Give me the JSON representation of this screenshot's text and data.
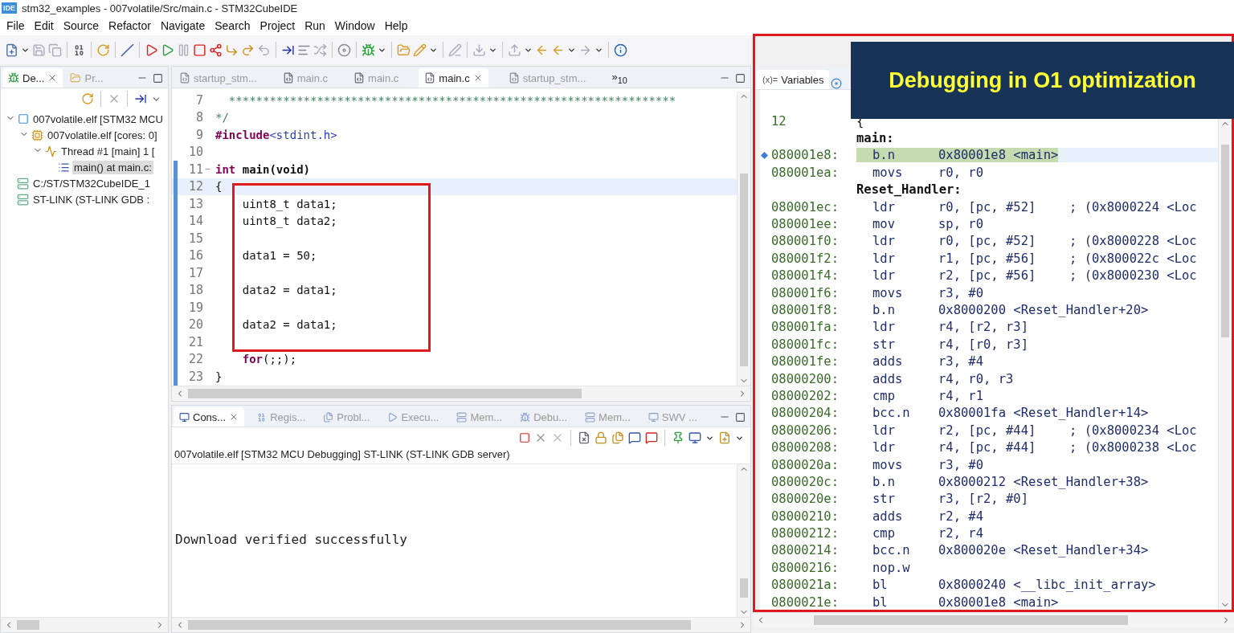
{
  "window": {
    "title": "stm32_examples - 007volatile/Src/main.c - STM32CubeIDE",
    "app_badge": "IDE"
  },
  "menu": [
    "File",
    "Edit",
    "Source",
    "Refactor",
    "Navigate",
    "Search",
    "Project",
    "Run",
    "Window",
    "Help"
  ],
  "debug_view": {
    "tabs": [
      {
        "label": "De...",
        "selected": true
      },
      {
        "label": "Pr...",
        "selected": false
      }
    ],
    "tree": [
      {
        "label": "007volatile.elf [STM32 MCU",
        "kind": "launch",
        "expanded": true,
        "selected": false,
        "children": [
          {
            "label": "007volatile.elf [cores: 0]",
            "kind": "process",
            "expanded": true,
            "selected": false,
            "children": [
              {
                "label": "Thread #1 [main] 1 [",
                "kind": "thread",
                "expanded": true,
                "selected": false,
                "children": [
                  {
                    "label": "main() at main.c:",
                    "kind": "frame",
                    "selected": true
                  }
                ]
              }
            ]
          }
        ]
      },
      {
        "label": "C:/ST/STM32CubeIDE_1",
        "kind": "server",
        "selected": false
      },
      {
        "label": "ST-LINK (ST-LINK GDB :",
        "kind": "server",
        "selected": false
      }
    ]
  },
  "editor": {
    "tabs": [
      {
        "label": "startup_stm...",
        "kind": "asm",
        "selected": false
      },
      {
        "label": "main.c",
        "kind": "c",
        "selected": false
      },
      {
        "label": "main.c",
        "kind": "c",
        "selected": false
      },
      {
        "label": "main.c",
        "kind": "c",
        "selected": true
      },
      {
        "label": "startup_stm...",
        "kind": "asm",
        "selected": false
      }
    ],
    "overflow": "»$_{10}$",
    "lines": [
      {
        "number": "7",
        "ruler": false,
        "fold": false,
        "current": false,
        "parts": [
          {
            "kind": "comment",
            "text": "  ******************************************************************"
          }
        ]
      },
      {
        "number": "8",
        "ruler": false,
        "fold": false,
        "current": false,
        "parts": [
          {
            "kind": "comment",
            "text": "*/"
          }
        ]
      },
      {
        "number": "9",
        "ruler": false,
        "fold": false,
        "current": false,
        "parts": [
          {
            "kind": "preproc",
            "text": "#include"
          },
          {
            "kind": "string",
            "text": "<stdint.h>"
          }
        ]
      },
      {
        "number": "10",
        "ruler": false,
        "fold": false,
        "current": false
      },
      {
        "number": "11",
        "ruler": true,
        "fold": true,
        "current": false,
        "parts": [
          {
            "kind": "keyword",
            "text": "int"
          },
          {
            "kind": "bold",
            "text": " main(void)"
          }
        ]
      },
      {
        "number": "12",
        "ruler": true,
        "fold": false,
        "current": true,
        "parts": [
          {
            "kind": "code",
            "text": "{"
          }
        ]
      },
      {
        "number": "13",
        "ruler": true,
        "fold": false,
        "current": false,
        "parts": [
          {
            "kind": "code",
            "text": "    uint8_t data1;"
          }
        ]
      },
      {
        "number": "14",
        "ruler": true,
        "fold": false,
        "current": false,
        "parts": [
          {
            "kind": "code",
            "text": "    uint8_t data2;"
          }
        ]
      },
      {
        "number": "15",
        "ruler": true,
        "fold": false,
        "current": false
      },
      {
        "number": "16",
        "ruler": true,
        "fold": false,
        "current": false,
        "parts": [
          {
            "kind": "code",
            "text": "    data1 = 50;"
          }
        ]
      },
      {
        "number": "17",
        "ruler": true,
        "fold": false,
        "current": false
      },
      {
        "number": "18",
        "ruler": true,
        "fold": false,
        "current": false,
        "parts": [
          {
            "kind": "code",
            "text": "    data2 = data1;"
          }
        ]
      },
      {
        "number": "19",
        "ruler": true,
        "fold": false,
        "current": false
      },
      {
        "number": "20",
        "ruler": true,
        "fold": false,
        "current": false,
        "parts": [
          {
            "kind": "code",
            "text": "    data2 = data1;"
          }
        ]
      },
      {
        "number": "21",
        "ruler": true,
        "fold": false,
        "current": false
      },
      {
        "number": "22",
        "ruler": true,
        "fold": false,
        "current": false,
        "parts": [
          {
            "kind": "keyword",
            "text": "    for"
          },
          {
            "kind": "code",
            "text": "(;;);"
          }
        ]
      },
      {
        "number": "23",
        "ruler": true,
        "fold": false,
        "current": false,
        "parts": [
          {
            "kind": "code",
            "text": "}"
          }
        ]
      }
    ]
  },
  "console": {
    "tabs": [
      {
        "label": "Cons...",
        "selected": true
      },
      {
        "label": "Regis...",
        "selected": false
      },
      {
        "label": "Probl...",
        "selected": false
      },
      {
        "label": "Execu...",
        "selected": false
      },
      {
        "label": "Mem...",
        "selected": false
      },
      {
        "label": "Debu...",
        "selected": false
      },
      {
        "label": "Mem...",
        "selected": false
      },
      {
        "label": "SWV ...",
        "selected": false
      }
    ],
    "header": "007volatile.elf [STM32 MCU Debugging] ST-LINK (ST-LINK GDB server)",
    "output": "Download verified successfully"
  },
  "disassembly": {
    "tabs": [
      {
        "glyph": "(x)=",
        "label": "Variables",
        "selected": true
      }
    ],
    "rows": [
      {
        "kind": "source",
        "address": "12",
        "text": "{"
      },
      {
        "kind": "label",
        "text": "main:"
      },
      {
        "kind": "instruction",
        "current": true,
        "address": "080001e8:",
        "mnemonic": "b.n",
        "operand": "0x80001e8 <main>"
      },
      {
        "kind": "instruction",
        "current": false,
        "address": "080001ea:",
        "mnemonic": "movs",
        "operand": "r0, r0"
      },
      {
        "kind": "label",
        "text": "Reset_Handler:"
      },
      {
        "kind": "instruction",
        "current": false,
        "address": "080001ec:",
        "mnemonic": "ldr",
        "operand": "r0, [pc, #52]",
        "comment": "; (0x8000224 <Loc"
      },
      {
        "kind": "instruction",
        "current": false,
        "address": "080001ee:",
        "mnemonic": "mov",
        "operand": "sp, r0"
      },
      {
        "kind": "instruction",
        "current": false,
        "address": "080001f0:",
        "mnemonic": "ldr",
        "operand": "r0, [pc, #52]",
        "comment": "; (0x8000228 <Loc"
      },
      {
        "kind": "instruction",
        "current": false,
        "address": "080001f2:",
        "mnemonic": "ldr",
        "operand": "r1, [pc, #56]",
        "comment": "; (0x800022c <Loc"
      },
      {
        "kind": "instruction",
        "current": false,
        "address": "080001f4:",
        "mnemonic": "ldr",
        "operand": "r2, [pc, #56]",
        "comment": "; (0x8000230 <Loc"
      },
      {
        "kind": "instruction",
        "current": false,
        "address": "080001f6:",
        "mnemonic": "movs",
        "operand": "r3, #0"
      },
      {
        "kind": "instruction",
        "current": false,
        "address": "080001f8:",
        "mnemonic": "b.n",
        "operand": "0x8000200 <Reset_Handler+20>"
      },
      {
        "kind": "instruction",
        "current": false,
        "address": "080001fa:",
        "mnemonic": "ldr",
        "operand": "r4, [r2, r3]"
      },
      {
        "kind": "instruction",
        "current": false,
        "address": "080001fc:",
        "mnemonic": "str",
        "operand": "r4, [r0, r3]"
      },
      {
        "kind": "instruction",
        "current": false,
        "address": "080001fe:",
        "mnemonic": "adds",
        "operand": "r3, #4"
      },
      {
        "kind": "instruction",
        "current": false,
        "address": "08000200:",
        "mnemonic": "adds",
        "operand": "r4, r0, r3"
      },
      {
        "kind": "instruction",
        "current": false,
        "address": "08000202:",
        "mnemonic": "cmp",
        "operand": "r4, r1"
      },
      {
        "kind": "instruction",
        "current": false,
        "address": "08000204:",
        "mnemonic": "bcc.n",
        "operand": "0x80001fa <Reset_Handler+14>"
      },
      {
        "kind": "instruction",
        "current": false,
        "address": "08000206:",
        "mnemonic": "ldr",
        "operand": "r2, [pc, #44]",
        "comment": "; (0x8000234 <Loc"
      },
      {
        "kind": "instruction",
        "current": false,
        "address": "08000208:",
        "mnemonic": "ldr",
        "operand": "r4, [pc, #44]",
        "comment": "; (0x8000238 <Loc"
      },
      {
        "kind": "instruction",
        "current": false,
        "address": "0800020a:",
        "mnemonic": "movs",
        "operand": "r3, #0"
      },
      {
        "kind": "instruction",
        "current": false,
        "address": "0800020c:",
        "mnemonic": "b.n",
        "operand": "0x8000212 <Reset_Handler+38>"
      },
      {
        "kind": "instruction",
        "current": false,
        "address": "0800020e:",
        "mnemonic": "str",
        "operand": "r3, [r2, #0]"
      },
      {
        "kind": "instruction",
        "current": false,
        "address": "08000210:",
        "mnemonic": "adds",
        "operand": "r2, #4"
      },
      {
        "kind": "instruction",
        "current": false,
        "address": "08000212:",
        "mnemonic": "cmp",
        "operand": "r2, r4"
      },
      {
        "kind": "instruction",
        "current": false,
        "address": "08000214:",
        "mnemonic": "bcc.n",
        "operand": "0x800020e <Reset_Handler+34>"
      },
      {
        "kind": "instruction",
        "current": false,
        "address": "08000216:",
        "mnemonic": "nop.w"
      },
      {
        "kind": "instruction",
        "current": false,
        "address": "0800021a:",
        "mnemonic": "bl",
        "operand": "0x8000240 <__libc_init_array>"
      },
      {
        "kind": "instruction",
        "current": false,
        "address": "0800021e:",
        "mnemonic": "bl",
        "operand": "0x80001e8 <main>"
      }
    ]
  },
  "banner": {
    "text": "Debugging in O1 optimization"
  }
}
